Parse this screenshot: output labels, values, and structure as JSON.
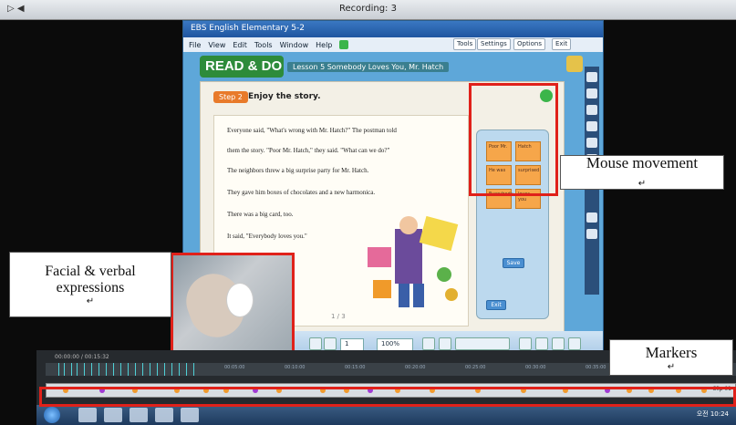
{
  "recorder": {
    "title": "Recording: 3",
    "left_controls": "▷ ◀"
  },
  "app": {
    "title": "EBS English Elementary 5-2",
    "menu": [
      "File",
      "View",
      "Edit",
      "Tools",
      "Window",
      "Help"
    ],
    "menu_buttons": [
      "Tools",
      "Settings",
      "Options",
      "Exit"
    ],
    "logo": "READ & DO",
    "unit": "Lesson 5  Somebody Loves You, Mr. Hatch",
    "step_badge": "Step 2",
    "step_title": "Enjoy the story.",
    "story_lines": [
      "Everyone said, \"What's wrong with Mr. Hatch?\"  The postman told",
      "them the story.  \"Poor Mr. Hatch,\" they said.  \"What can we do?\"",
      "The neighbors threw a big surprise party for Mr. Hatch.",
      "They gave him boxes of chocolates and a new harmonica.",
      "There was a big card, too.",
      "It said, \"Everybody loves you.\""
    ],
    "page_indicator": "1 / 3",
    "card_labels": [
      "Poor Mr.",
      "Hatch",
      "He was",
      "surprised",
      "Everybody",
      "loves you"
    ],
    "side_buttons": [
      "Save",
      "Exit"
    ],
    "zoom": "100%",
    "page_select": "1"
  },
  "webcam": {
    "label": "webcam feed"
  },
  "timeline": {
    "header": "00:00:00 / 00:15:32",
    "times": [
      "00:05:00",
      "00:10:00",
      "00:15:00",
      "00:20:00",
      "00:25:00",
      "00:30:00",
      "00:35:00"
    ],
    "end_label": "Clip 01"
  },
  "taskbar": {
    "tray": "오전 10:24"
  },
  "annotations": {
    "mouse": "Mouse movement",
    "facial_line1": "Facial & verbal",
    "facial_line2": "expressions",
    "markers": "Markers",
    "return_mark": "↵"
  }
}
